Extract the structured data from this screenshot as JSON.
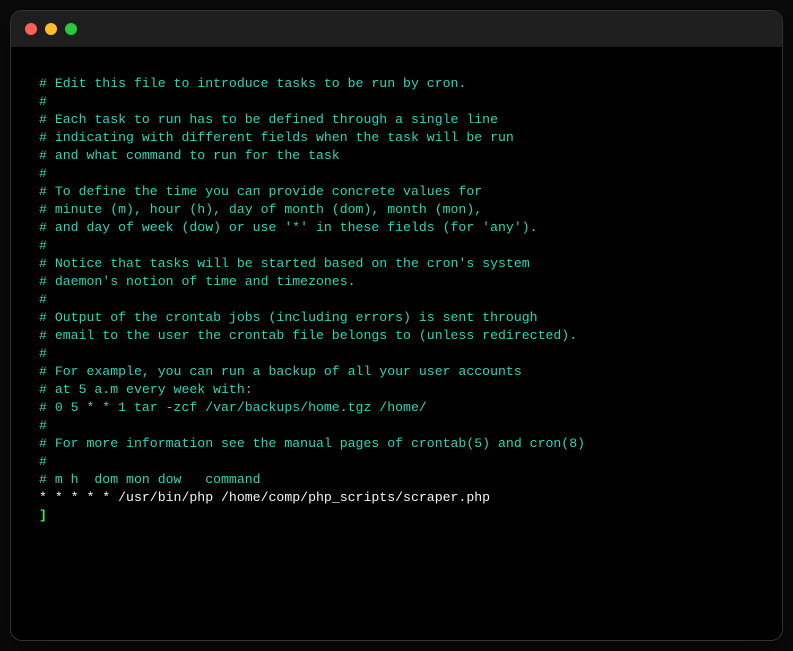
{
  "crontab": {
    "comment_lines": [
      "# Edit this file to introduce tasks to be run by cron.",
      "#",
      "# Each task to run has to be defined through a single line",
      "# indicating with different fields when the task will be run",
      "# and what command to run for the task",
      "#",
      "# To define the time you can provide concrete values for",
      "# minute (m), hour (h), day of month (dom), month (mon),",
      "# and day of week (dow) or use '*' in these fields (for 'any').",
      "#",
      "# Notice that tasks will be started based on the cron's system",
      "# daemon's notion of time and timezones.",
      "#",
      "# Output of the crontab jobs (including errors) is sent through",
      "# email to the user the crontab file belongs to (unless redirected).",
      "#",
      "# For example, you can run a backup of all your user accounts",
      "# at 5 a.m every week with:",
      "# 0 5 * * 1 tar -zcf /var/backups/home.tgz /home/",
      "#",
      "# For more information see the manual pages of crontab(5) and cron(8)",
      "#",
      "# m h  dom mon dow   command"
    ],
    "command_line": "* * * * * /usr/bin/php /home/comp/php_scripts/scraper.php",
    "cursor": "]"
  }
}
